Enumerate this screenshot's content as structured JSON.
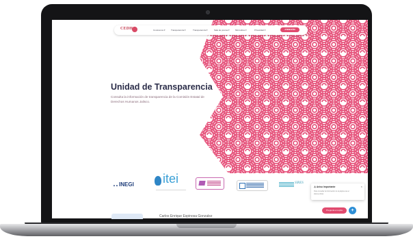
{
  "browser": {
    "title": ""
  },
  "brand": {
    "logo_text": "CEDHJ",
    "accent": "#e04a6e",
    "title_color": "#2a2c48",
    "pattern_color": "#e6557d"
  },
  "nav": {
    "items": [
      {
        "label": "Conócenos ▾"
      },
      {
        "label": "Transparencia ▾"
      },
      {
        "label": "Transparencia ▾"
      },
      {
        "label": "Sala de prensa ▾"
      },
      {
        "label": "Micrositios ▾"
      },
      {
        "label": "Privacidad ▾"
      }
    ],
    "button_label": "ATENCIÓN"
  },
  "hero": {
    "title": "Unidad de Transparencia",
    "subtitle": "Consulta la información de transparencia de la Comisión Estatal de Derechos Humanos Jalisco."
  },
  "partners": {
    "inegi": "INEGI",
    "itei": "itei",
    "sires": "SIRES"
  },
  "notice": {
    "title": "Aviso Importante",
    "close": "×",
    "body": "Para consultar la información de la página usa el idioma oficial."
  },
  "footer": {
    "help_label": "Pregunta a Lupita",
    "fab_label": "+",
    "bottom_text": "Carlos Enrique Espinosa Gonzalez"
  }
}
